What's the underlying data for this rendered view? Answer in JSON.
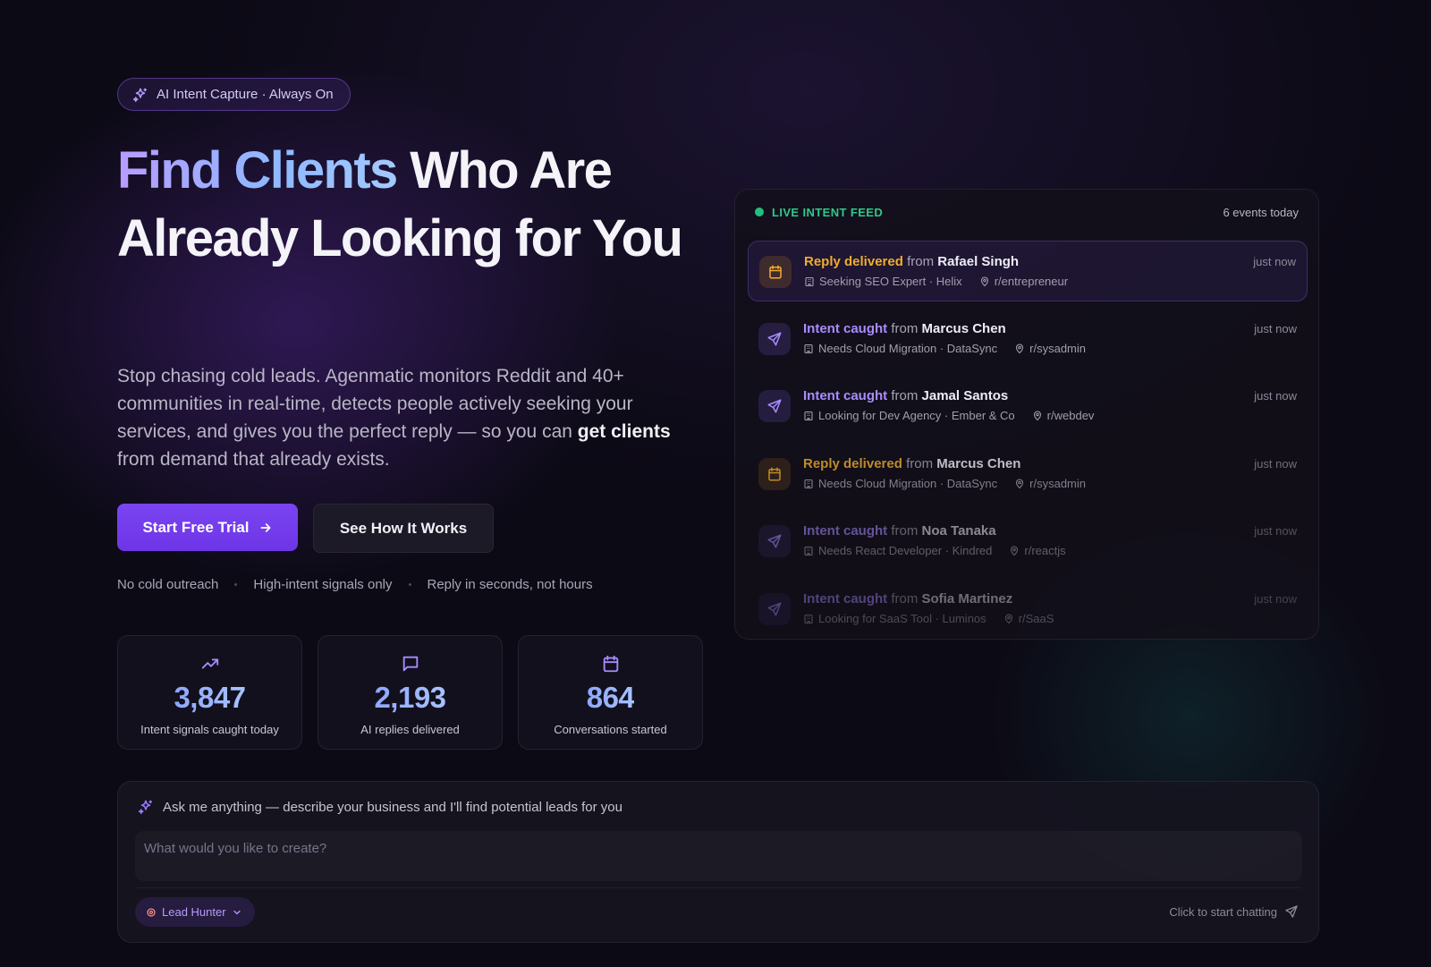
{
  "badge": {
    "label": "AI Intent Capture · Always On",
    "icon": "sparkles-icon"
  },
  "hero": {
    "title_gradient": "Find Clients",
    "title_rest": " Who Are Already Looking for You",
    "subtitle_before": "Stop chasing cold leads. Agenmatic monitors Reddit and 40+ communities in real-time, detects people actively seeking your services, and gives you the perfect reply — so you can ",
    "subtitle_bold": "get clients",
    "subtitle_after": " from demand that already exists."
  },
  "cta": {
    "primary_label": "Start Free Trial",
    "primary_icon": "arrow-right-icon",
    "secondary_label": "See How It Works"
  },
  "perks": [
    "No cold outreach",
    "High-intent signals only",
    "Reply in seconds, not hours"
  ],
  "stats": [
    {
      "value": "3,847",
      "label": "Intent signals caught today",
      "icon": "trending-up-icon"
    },
    {
      "value": "2,193",
      "label": "AI replies delivered",
      "icon": "message-square-icon"
    },
    {
      "value": "864",
      "label": "Conversations started",
      "icon": "calendar-icon"
    }
  ],
  "feed": {
    "title": "LIVE INTENT FEED",
    "count": "6 events today",
    "items": [
      {
        "kind": "Reply delivered",
        "from": "from",
        "name": "Rafael Singh",
        "need": "Seeking SEO Expert · Helix",
        "community": "r/entrepreneur",
        "time": "just now"
      },
      {
        "kind": "Intent caught",
        "from": "from",
        "name": "Marcus Chen",
        "need": "Needs Cloud Migration · DataSync",
        "community": "r/sysadmin",
        "time": "just now"
      },
      {
        "kind": "Intent caught",
        "from": "from",
        "name": "Jamal Santos",
        "need": "Looking for Dev Agency · Ember & Co",
        "community": "r/webdev",
        "time": "just now"
      },
      {
        "kind": "Reply delivered",
        "from": "from",
        "name": "Marcus Chen",
        "need": "Needs Cloud Migration · DataSync",
        "community": "r/sysadmin",
        "time": "just now"
      },
      {
        "kind": "Intent caught",
        "from": "from",
        "name": "Noa Tanaka",
        "need": "Needs React Developer · Kindred",
        "community": "r/reactjs",
        "time": "just now"
      },
      {
        "kind": "Intent caught",
        "from": "from",
        "name": "Sofia Martinez",
        "need": "Looking for SaaS Tool · Luminos",
        "community": "r/SaaS",
        "time": "just now"
      }
    ]
  },
  "chat": {
    "prompt": "Ask me anything — describe your business and I'll find potential leads for you",
    "placeholder": "What would you like to create?",
    "agent_label": "Lead Hunter",
    "cta_label": "Click to start chatting"
  },
  "colors": {
    "accent": "#7b44f2",
    "amber": "#f0ad2e",
    "violet": "#a98cff",
    "live_green": "#22c07f",
    "background": "#0c0a15"
  }
}
